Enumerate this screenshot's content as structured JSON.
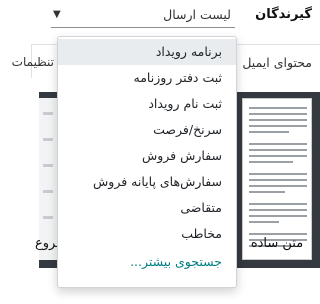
{
  "field": {
    "label": "گیرندگان",
    "value": "لیست ارسال"
  },
  "tabs": {
    "content": "محتوای ایمیل",
    "left_partial": "تنظیمات"
  },
  "cards": {
    "right_label": "متن ساده",
    "left_label": "شروع"
  },
  "dropdown": {
    "items": [
      "برنامه رویداد",
      "ثبت دفتر روزنامه",
      "ثبت نام رویداد",
      "سرنخ/فرصت",
      "سفارش فروش",
      "سفارش‌های پایانه فروش",
      "متقاضی",
      "مخاطب"
    ],
    "more": "جستجوی بیشتر..."
  }
}
